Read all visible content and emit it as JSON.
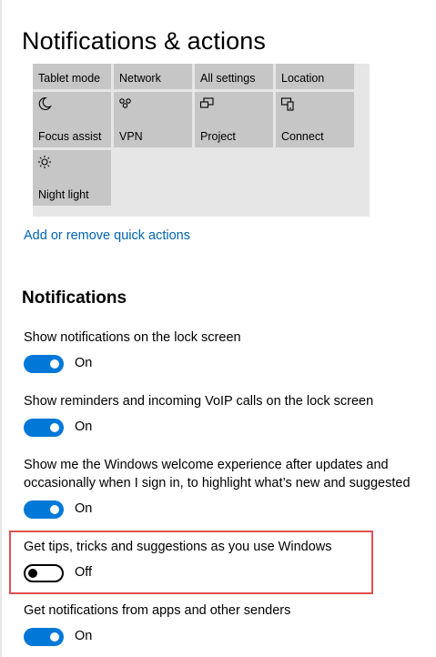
{
  "page": {
    "title": "Notifications & actions"
  },
  "quick_actions": {
    "tiles": [
      {
        "label": "Tablet mode",
        "icon": "none"
      },
      {
        "label": "Network",
        "icon": "none"
      },
      {
        "label": "All settings",
        "icon": "none"
      },
      {
        "label": "Location",
        "icon": "none"
      },
      {
        "label": "Focus assist",
        "icon": "moon-icon"
      },
      {
        "label": "VPN",
        "icon": "vpn-icon"
      },
      {
        "label": "Project",
        "icon": "project-icon"
      },
      {
        "label": "Connect",
        "icon": "connect-icon"
      },
      {
        "label": "Night light",
        "icon": "sun-icon"
      }
    ],
    "link": "Add or remove quick actions"
  },
  "notifications": {
    "title": "Notifications",
    "settings": [
      {
        "label": "Show notifications on the lock screen",
        "state": "On",
        "on": true
      },
      {
        "label": "Show reminders and incoming VoIP calls on the lock screen",
        "state": "On",
        "on": true
      },
      {
        "label_line1": "Show me the Windows welcome experience after updates and",
        "label_line2": "occasionally when I sign in, to highlight what’s new and suggested",
        "state": "On",
        "on": true
      },
      {
        "label": "Get tips, tricks and suggestions as you use Windows",
        "state": "Off",
        "on": false
      },
      {
        "label": "Get notifications from apps and other senders",
        "state": "On",
        "on": true
      }
    ]
  },
  "colors": {
    "accent": "#0078d7",
    "link": "#0063b1",
    "highlight": "#e05050",
    "tile": "#c6c6c6",
    "panel": "#e6e6e6"
  }
}
